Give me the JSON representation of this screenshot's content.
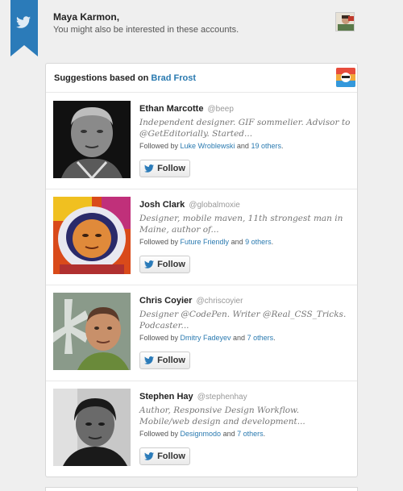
{
  "header": {
    "user_name": "Maya Karmon,",
    "message": "You might also be interested in these accounts."
  },
  "card": {
    "title_prefix": "Suggestions based on ",
    "based_on": "Brad Frost"
  },
  "suggestions": [
    {
      "name": "Ethan Marcotte",
      "handle": "@beep",
      "bio": "Independent designer. GIF sommelier. Advisor to @GetEditorially. Started...",
      "followed_prefix": "Followed by ",
      "followed_by": "Luke Wroblewski",
      "followed_and": " and ",
      "followed_others": "19 others",
      "followed_suffix": ".",
      "button": "Follow"
    },
    {
      "name": "Josh Clark",
      "handle": "@globalmoxie",
      "bio": "Designer, mobile maven, 11th strongest man in Maine, author of...",
      "followed_prefix": "Followed by ",
      "followed_by": "Future Friendly",
      "followed_and": " and ",
      "followed_others": "9 others",
      "followed_suffix": ".",
      "button": "Follow"
    },
    {
      "name": "Chris Coyier",
      "handle": "@chriscoyier",
      "bio": "Designer @CodePen. Writer @Real_CSS_Tricks. Podcaster...",
      "followed_prefix": "Followed by ",
      "followed_by": "Dmitry Fadeyev",
      "followed_and": " and ",
      "followed_others": "7 others",
      "followed_suffix": ".",
      "button": "Follow"
    },
    {
      "name": "Stephen Hay",
      "handle": "@stephenhay",
      "bio": "Author, Responsive Design Workflow. Mobile/web design and development...",
      "followed_prefix": "Followed by ",
      "followed_by": "Designmodo",
      "followed_and": " and ",
      "followed_others": "7 others",
      "followed_suffix": ".",
      "button": "Follow"
    }
  ],
  "colors": {
    "brand_blue": "#2b7bb9",
    "link": "#2a7ab0",
    "background": "#efefef"
  }
}
